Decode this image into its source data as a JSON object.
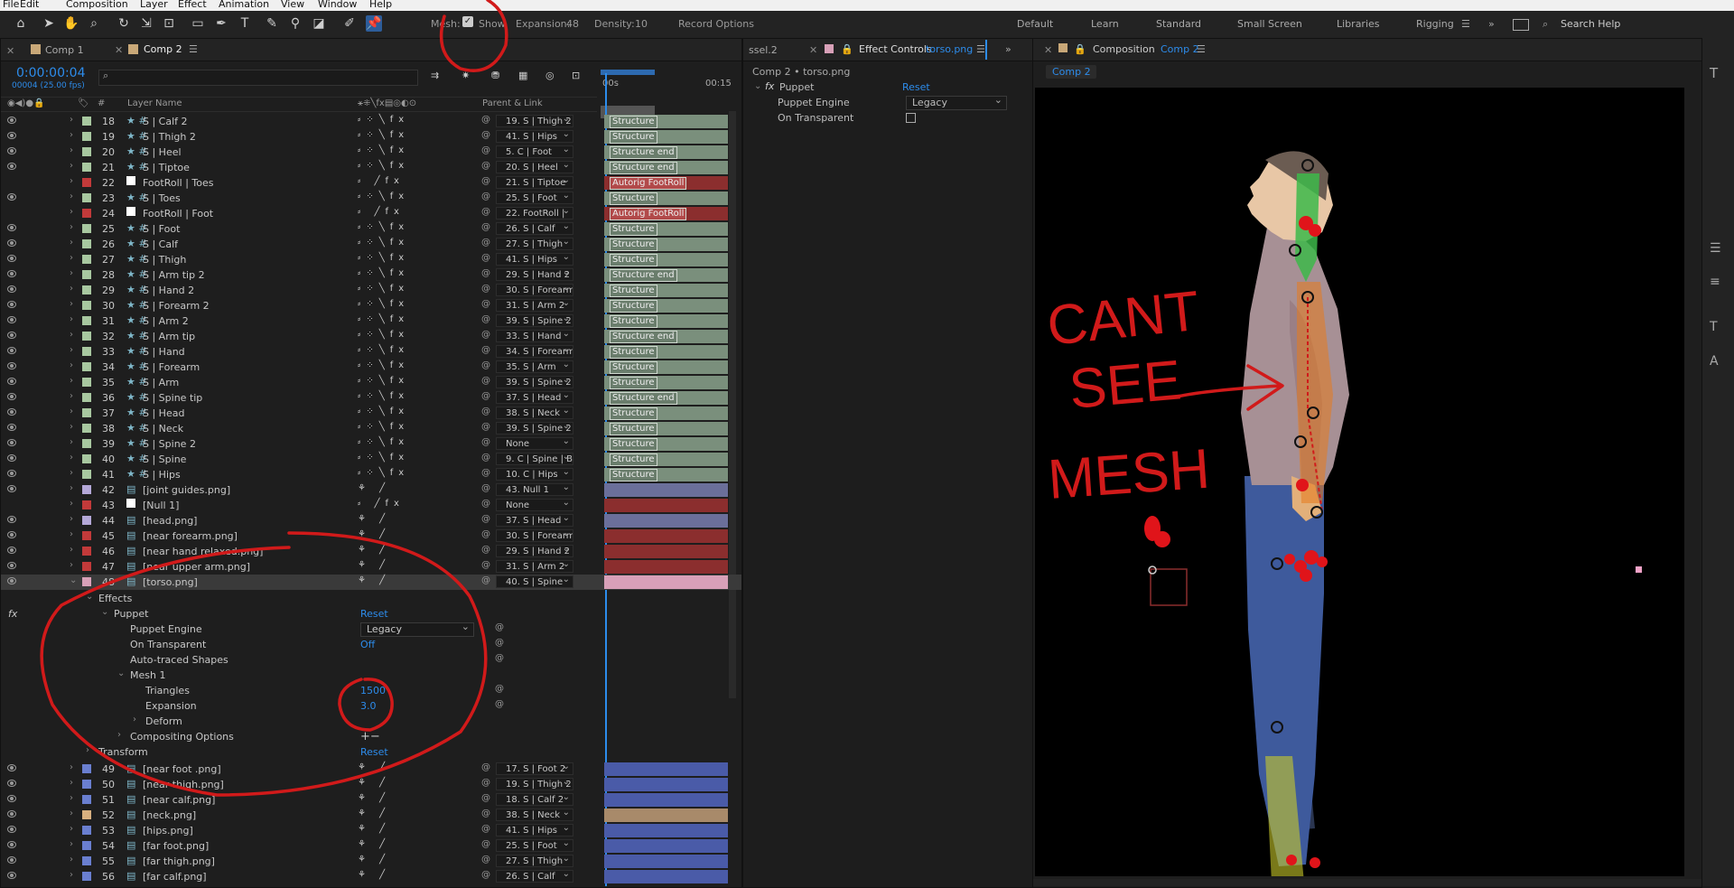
{
  "menu": [
    "File",
    "Edit",
    "Composition",
    "Layer",
    "Effect",
    "Animation",
    "View",
    "Window",
    "Help"
  ],
  "toolbar": {
    "mesh_label": "Mesh:",
    "show_label": "Show",
    "expansion_label": "Expansion:",
    "expansion_value": "48",
    "density_label": "Density:",
    "density_value": "10",
    "record_options": "Record Options"
  },
  "workspaces": [
    "Default",
    "Learn",
    "Standard",
    "Small Screen",
    "Libraries",
    "Rigging"
  ],
  "search_help": "Search Help",
  "timeline": {
    "tabs": [
      "Comp 1",
      "Comp 2"
    ],
    "timecode": "0:00:00:04",
    "frames": "00004 (25.00 fps)",
    "col_layer_name": "Layer Name",
    "col_parent": "Parent & Link",
    "col_hash": "#",
    "ruler": [
      "00s",
      "00:15"
    ],
    "layers": [
      {
        "num": "18",
        "name": "S | Calf 2",
        "parent": "19. S | Thigh 2",
        "bar": "Structure",
        "color": "#a8c8a0",
        "kind": "s"
      },
      {
        "num": "19",
        "name": "S | Thigh 2",
        "parent": "41. S | Hips",
        "bar": "Structure",
        "color": "#a8c8a0",
        "kind": "s"
      },
      {
        "num": "20",
        "name": "S | Heel",
        "parent": "5. C | Foot",
        "bar": "Structure end",
        "color": "#a8c8a0",
        "kind": "s"
      },
      {
        "num": "21",
        "name": "S | Tiptoe",
        "parent": "20. S | Heel",
        "bar": "Structure end",
        "color": "#a8c8a0",
        "kind": "s"
      },
      {
        "num": "22",
        "name": "FootRoll | Toes",
        "parent": "21. S | Tiptoe",
        "bar": "Autorig FootRoll",
        "color": "#c23a3a",
        "kind": "f"
      },
      {
        "num": "23",
        "name": "S | Toes",
        "parent": "25. S | Foot",
        "bar": "Structure",
        "color": "#a8c8a0",
        "kind": "s"
      },
      {
        "num": "24",
        "name": "FootRoll | Foot",
        "parent": "22. FootRoll |",
        "bar": "Autorig FootRoll",
        "color": "#c23a3a",
        "kind": "f"
      },
      {
        "num": "25",
        "name": "S | Foot",
        "parent": "26. S | Calf",
        "bar": "Structure",
        "color": "#a8c8a0",
        "kind": "s"
      },
      {
        "num": "26",
        "name": "S | Calf",
        "parent": "27. S | Thigh",
        "bar": "Structure",
        "color": "#a8c8a0",
        "kind": "s"
      },
      {
        "num": "27",
        "name": "S | Thigh",
        "parent": "41. S | Hips",
        "bar": "Structure",
        "color": "#a8c8a0",
        "kind": "s"
      },
      {
        "num": "28",
        "name": "S | Arm tip 2",
        "parent": "29. S | Hand 2",
        "bar": "Structure end",
        "color": "#a8c8a0",
        "kind": "s"
      },
      {
        "num": "29",
        "name": "S | Hand 2",
        "parent": "30. S | Forearm",
        "bar": "Structure",
        "color": "#a8c8a0",
        "kind": "s"
      },
      {
        "num": "30",
        "name": "S | Forearm 2",
        "parent": "31. S | Arm 2",
        "bar": "Structure",
        "color": "#a8c8a0",
        "kind": "s"
      },
      {
        "num": "31",
        "name": "S | Arm 2",
        "parent": "39. S | Spine 2",
        "bar": "Structure",
        "color": "#a8c8a0",
        "kind": "s"
      },
      {
        "num": "32",
        "name": "S | Arm tip",
        "parent": "33. S | Hand",
        "bar": "Structure end",
        "color": "#a8c8a0",
        "kind": "s"
      },
      {
        "num": "33",
        "name": "S | Hand",
        "parent": "34. S | Forearm",
        "bar": "Structure",
        "color": "#a8c8a0",
        "kind": "s"
      },
      {
        "num": "34",
        "name": "S | Forearm",
        "parent": "35. S | Arm",
        "bar": "Structure",
        "color": "#a8c8a0",
        "kind": "s"
      },
      {
        "num": "35",
        "name": "S | Arm",
        "parent": "39. S | Spine 2",
        "bar": "Structure",
        "color": "#a8c8a0",
        "kind": "s"
      },
      {
        "num": "36",
        "name": "S | Spine tip",
        "parent": "37. S | Head",
        "bar": "Structure end",
        "color": "#a8c8a0",
        "kind": "s"
      },
      {
        "num": "37",
        "name": "S | Head",
        "parent": "38. S | Neck",
        "bar": "Structure",
        "color": "#a8c8a0",
        "kind": "s"
      },
      {
        "num": "38",
        "name": "S | Neck",
        "parent": "39. S | Spine 2",
        "bar": "Structure",
        "color": "#a8c8a0",
        "kind": "s"
      },
      {
        "num": "39",
        "name": "S | Spine 2",
        "parent": "None",
        "bar": "Structure",
        "color": "#a8c8a0",
        "kind": "s"
      },
      {
        "num": "40",
        "name": "S | Spine",
        "parent": "9. C | Spine | B",
        "bar": "Structure",
        "color": "#a8c8a0",
        "kind": "s"
      },
      {
        "num": "41",
        "name": "S | Hips",
        "parent": "10. C | Hips",
        "bar": "Structure",
        "color": "#a8c8a0",
        "kind": "s"
      },
      {
        "num": "42",
        "name": "[joint guides.png]",
        "parent": "43. Null 1",
        "bar": "",
        "color": "#b4a8d8",
        "kind": "p"
      },
      {
        "num": "43",
        "name": "[Null 1]",
        "parent": "None",
        "bar": "",
        "color": "#c23a3a",
        "kind": "n"
      },
      {
        "num": "44",
        "name": "[head.png]",
        "parent": "37. S | Head",
        "bar": "",
        "color": "#b4a8d8",
        "kind": "p"
      },
      {
        "num": "45",
        "name": "[near forearm.png]",
        "parent": "30. S | Forearm",
        "bar": "",
        "color": "#c23a3a",
        "kind": "p"
      },
      {
        "num": "46",
        "name": "[near hand relaxed.png]",
        "parent": "29. S | Hand 2",
        "bar": "",
        "color": "#c23a3a",
        "kind": "p"
      },
      {
        "num": "47",
        "name": "[near upper arm.png]",
        "parent": "31. S | Arm 2",
        "bar": "",
        "color": "#c23a3a",
        "kind": "p"
      },
      {
        "num": "48",
        "name": "[torso.png]",
        "parent": "40. S | Spine",
        "bar": "",
        "color": "#d8a0b8",
        "kind": "p",
        "selected": true
      }
    ],
    "effects": {
      "effects_label": "Effects",
      "puppet_label": "Puppet",
      "reset": "Reset",
      "engine_label": "Puppet Engine",
      "engine_value": "Legacy",
      "transparent_label": "On Transparent",
      "transparent_value": "Off",
      "auto_traced": "Auto-traced Shapes",
      "mesh1": "Mesh 1",
      "triangles_label": "Triangles",
      "triangles_value": "1500",
      "expansion_label": "Expansion",
      "expansion_value": "3.0",
      "deform": "Deform",
      "compositing": "Compositing Options",
      "transform": "Transform"
    },
    "layers_bottom": [
      {
        "num": "49",
        "name": "[near foot .png]",
        "parent": "17. S | Foot 2",
        "color": "#6a7fd0"
      },
      {
        "num": "50",
        "name": "[near thigh.png]",
        "parent": "19. S | Thigh 2",
        "color": "#6a7fd0"
      },
      {
        "num": "51",
        "name": "[near calf.png]",
        "parent": "18. S | Calf 2",
        "color": "#6a7fd0"
      },
      {
        "num": "52",
        "name": "[neck.png]",
        "parent": "38. S | Neck",
        "color": "#d8b080"
      },
      {
        "num": "53",
        "name": "[hips.png]",
        "parent": "41. S | Hips",
        "color": "#6a7fd0"
      },
      {
        "num": "54",
        "name": "[far foot.png]",
        "parent": "25. S | Foot",
        "color": "#6a7fd0"
      },
      {
        "num": "55",
        "name": "[far thigh.png]",
        "parent": "27. S | Thigh",
        "color": "#6a7fd0"
      },
      {
        "num": "56",
        "name": "[far calf.png]",
        "parent": "26. S | Calf",
        "color": "#6a7fd0"
      }
    ]
  },
  "effect_controls": {
    "tab_prefix": "ssel.2",
    "tab_title": "Effect Controls",
    "tab_layer": "torso.png",
    "breadcrumb": "Comp 2 • torso.png",
    "puppet_label": "Puppet",
    "reset": "Reset",
    "engine_label": "Puppet Engine",
    "engine_value": "Legacy",
    "transparent_label": "On Transparent"
  },
  "composition": {
    "tab_prefix": "Composition",
    "tab_name": "Comp 2",
    "subtab": "Comp 2"
  },
  "annotation": {
    "line1": "CANT",
    "line2": "SEE",
    "line3": "MESH"
  },
  "colors": {
    "accent": "#2d8ceb",
    "annotation": "#d11a1a",
    "bar_structure": "#7a8f7c",
    "bar_footroll": "#8b2e2e",
    "bar_purple": "#6b6f9a",
    "bar_red": "#8b2e2e",
    "bar_pink": "#d8a0b8",
    "bar_blue": "#4a5ba8",
    "bar_tan": "#a88a6a"
  }
}
